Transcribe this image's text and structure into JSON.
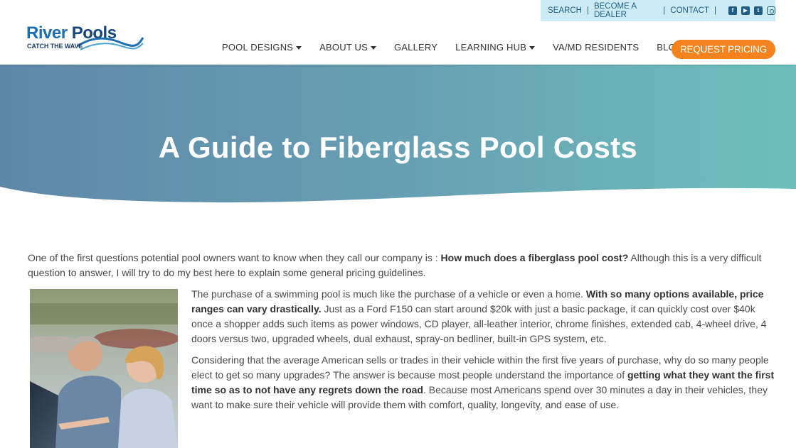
{
  "utility": {
    "search": "SEARCH",
    "dealer": "BECOME A DEALER",
    "contact": "CONTACT",
    "social_icons": [
      "facebook-icon",
      "youtube-icon",
      "twitter-icon",
      "instagram-icon"
    ]
  },
  "logo": {
    "word1": "River",
    "word2": "Pools",
    "tagline": "CATCH THE WAVE"
  },
  "nav": {
    "pool_designs": "POOL DESIGNS",
    "about_us": "ABOUT US",
    "gallery": "GALLERY",
    "learning_hub": "LEARNING HUB",
    "residents": "VA/MD RESIDENTS",
    "blog": "BLOG",
    "cta": "REQUEST PRICING"
  },
  "hero": {
    "title": "A Guide to Fiberglass Pool Costs"
  },
  "content": {
    "intro_a": "One of the first questions potential pool owners want to know when they call our company is : ",
    "intro_bold": "How much does a fiberglass pool cost?",
    "intro_b": " Although this is a very difficult question to answer, I will try to do my best here to explain some general pricing guidelines.",
    "p1_a": "The purchase of a swimming pool is much like the purchase of a vehicle or even a home. ",
    "p1_bold": "With so many options available, price ranges can vary drastically.",
    "p1_b": " Just as a Ford F150 can start around $20k with just a basic package, it can quickly cost over $40k once a shopper adds such items as power windows, CD player, all-leather interior, chrome finishes, extended cab, 4-wheel drive, 4 doors versus two, upgraded wheels, dual exhaust, spray-on bedliner, built-in GPS system, etc.",
    "p2_a": "Considering that the average American sells or trades in their vehicle within the first five years of purchase, why do so many people elect to get so many upgrades? The answer is because most people understand the importance of ",
    "p2_bold": "getting what they want the first time so as to not have any regrets down the road",
    "p2_b": ". Because most Americans spend over 30 minutes a day in their vehicles, they want to make sure their vehicle will provide them with comfort, quality, longevity, and ease of use."
  },
  "colors": {
    "accent_orange": "#f4821f",
    "hero_left": "#5e88a8",
    "hero_right": "#6dbfbc",
    "utility_bg": "#cdebf5",
    "logo_blue": "#1e6fb0"
  }
}
